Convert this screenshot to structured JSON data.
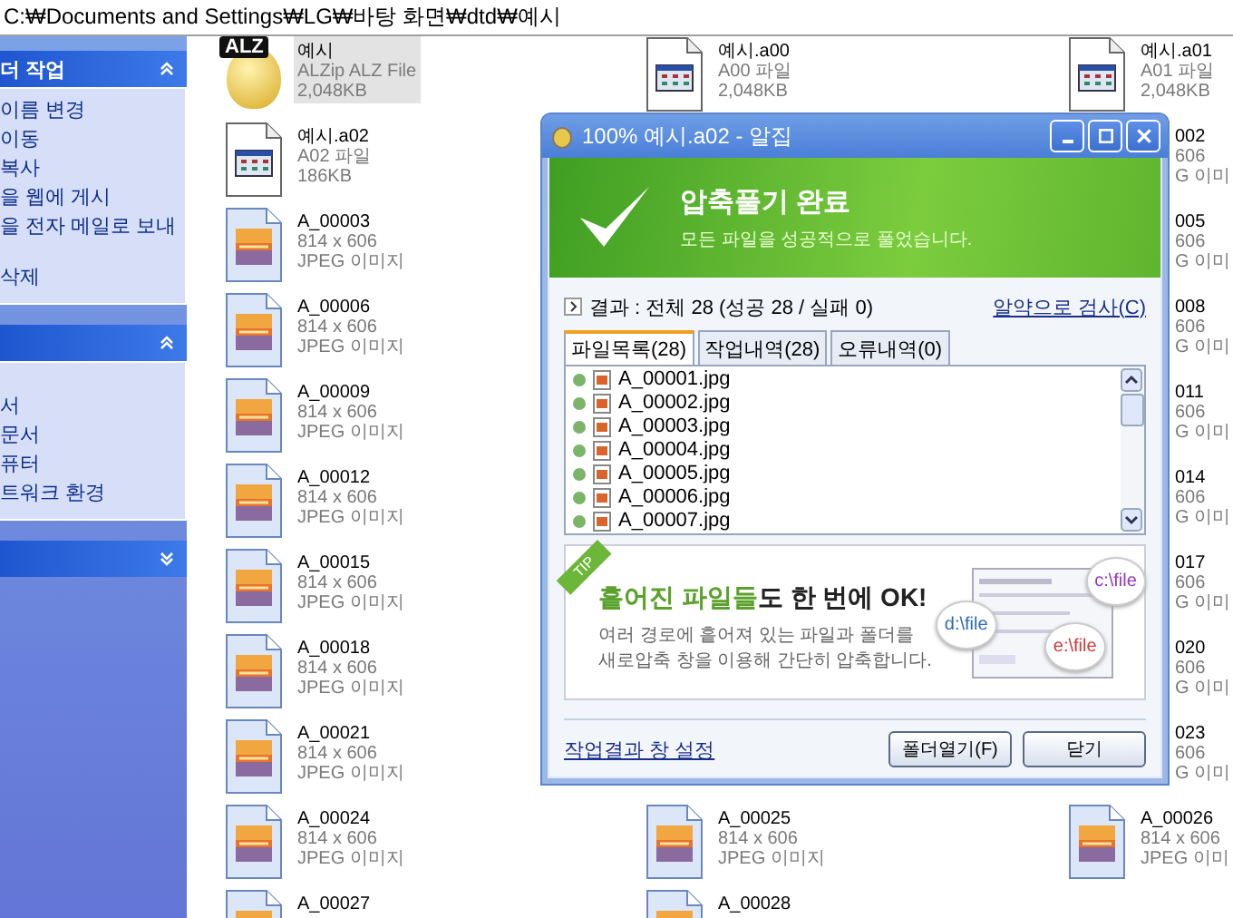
{
  "address_bar": {
    "path": "C:₩Documents and Settings₩LG₩바탕 화면₩dtd₩예시"
  },
  "sidebar": {
    "panels": [
      {
        "title": "더 작업",
        "expanded": true,
        "items": [
          {
            "label": "이름 변경",
            "spaced": false
          },
          {
            "label": "이동",
            "spaced": false
          },
          {
            "label": "복사",
            "spaced": false
          },
          {
            "label": "을 웹에 게시",
            "spaced": false
          },
          {
            "label": "을 전자 메일로 보내",
            "spaced": false
          },
          {
            "label": "삭제",
            "spaced": true
          }
        ]
      },
      {
        "expanded": true,
        "items": [
          {
            "label": "서",
            "spaced": true
          },
          {
            "label": "문서",
            "spaced": false
          },
          {
            "label": "퓨터",
            "spaced": false
          },
          {
            "label": "트워크 환경",
            "spaced": false
          }
        ]
      },
      {
        "expanded": false
      }
    ]
  },
  "file_columns": [
    [
      {
        "kind": "archive",
        "icon_label": "ALZ",
        "name": "예시",
        "line2": "ALZip ALZ File",
        "line3": "2,048KB",
        "selected": true
      },
      {
        "kind": "split",
        "name": "예시.a02",
        "line2": "A02 파일",
        "line3": "186KB",
        "selected": false
      },
      {
        "kind": "image",
        "name": "A_00003",
        "line2": "814 x 606",
        "line3": "JPEG 이미지",
        "selected": false
      },
      {
        "kind": "image",
        "name": "A_00006",
        "line2": "814 x 606",
        "line3": "JPEG 이미지",
        "selected": false
      },
      {
        "kind": "image",
        "name": "A_00009",
        "line2": "814 x 606",
        "line3": "JPEG 이미지",
        "selected": false
      },
      {
        "kind": "image",
        "name": "A_00012",
        "line2": "814 x 606",
        "line3": "JPEG 이미지",
        "selected": false
      },
      {
        "kind": "image",
        "name": "A_00015",
        "line2": "814 x 606",
        "line3": "JPEG 이미지",
        "selected": false
      },
      {
        "kind": "image",
        "name": "A_00018",
        "line2": "814 x 606",
        "line3": "JPEG 이미지",
        "selected": false
      },
      {
        "kind": "image",
        "name": "A_00021",
        "line2": "814 x 606",
        "line3": "JPEG 이미지",
        "selected": false
      },
      {
        "kind": "image",
        "name": "A_00024",
        "line2": "814 x 606",
        "line3": "JPEG 이미지",
        "selected": false
      },
      {
        "kind": "image",
        "name": "A_00027",
        "selected": false
      }
    ],
    [
      {
        "kind": "split",
        "name": "예시.a00",
        "line2": "A00 파일",
        "line3": "2,048KB",
        "selected": false
      },
      {
        "kind": "image",
        "name": "A_00025",
        "line2": "814 x 606",
        "line3": "JPEG 이미지",
        "selected": false,
        "after_gap": true
      },
      {
        "kind": "image",
        "name": "A_00028",
        "selected": false
      }
    ],
    [
      {
        "kind": "split",
        "name": "예시.a01",
        "line2": "A01 파일",
        "line3": "2,048KB",
        "selected": false
      },
      {
        "kind": "partial",
        "name": "002",
        "line2": "606",
        "line3": "G 이미",
        "selected": false
      },
      {
        "kind": "partial",
        "name": "005",
        "line2": "606",
        "line3": "G 이미",
        "selected": false
      },
      {
        "kind": "partial",
        "name": "008",
        "line2": "606",
        "line3": "G 이미",
        "selected": false
      },
      {
        "kind": "partial",
        "name": "011",
        "line2": "606",
        "line3": "G 이미",
        "selected": false
      },
      {
        "kind": "partial",
        "name": "014",
        "line2": "606",
        "line3": "G 이미",
        "selected": false
      },
      {
        "kind": "partial",
        "name": "017",
        "line2": "606",
        "line3": "G 이미",
        "selected": false
      },
      {
        "kind": "partial",
        "name": "020",
        "line2": "606",
        "line3": "G 이미",
        "selected": false
      },
      {
        "kind": "partial",
        "name": "023",
        "line2": "606",
        "line3": "G 이미",
        "selected": false
      },
      {
        "kind": "image",
        "name": "A_00026",
        "line2": "814 x 606",
        "line3": "JPEG 이미",
        "selected": false
      }
    ]
  ],
  "dialog": {
    "title": "100% 예시.a02 - 알집",
    "banner": {
      "title": "압축풀기 완료",
      "message": "모든 파일을 성공적으로 풀었습니다."
    },
    "result": "결과 : 전체 28 (성공 28 / 실패 0)",
    "scan_link": "알약으로 검사(C)",
    "tabs": [
      {
        "label": "파일목록(28)",
        "selected": true
      },
      {
        "label": "작업내역(28)",
        "selected": false
      },
      {
        "label": "오류내역(0)",
        "selected": false
      }
    ],
    "files": [
      "A_00001.jpg",
      "A_00002.jpg",
      "A_00003.jpg",
      "A_00004.jpg",
      "A_00005.jpg",
      "A_00006.jpg",
      "A_00007.jpg"
    ],
    "tip": {
      "badge": "TIP",
      "headline_highlight": "흩어진 파일들",
      "headline_rest": "도 한 번에 OK!",
      "lines": [
        "여러 경로에 흩어져 있는 파일과 폴더를",
        "새로압축 창을 이용해 간단히 압축합니다."
      ],
      "bubbles": [
        {
          "label": "d:\\file",
          "color": "#2d6bb0"
        },
        {
          "label": "c:\\file",
          "color": "#9b35c0"
        },
        {
          "label": "e:\\file",
          "color": "#d03a3a"
        }
      ]
    },
    "settings_link": "작업결과 창 설정",
    "buttons": [
      "폴더열기(F)",
      "닫기"
    ]
  }
}
